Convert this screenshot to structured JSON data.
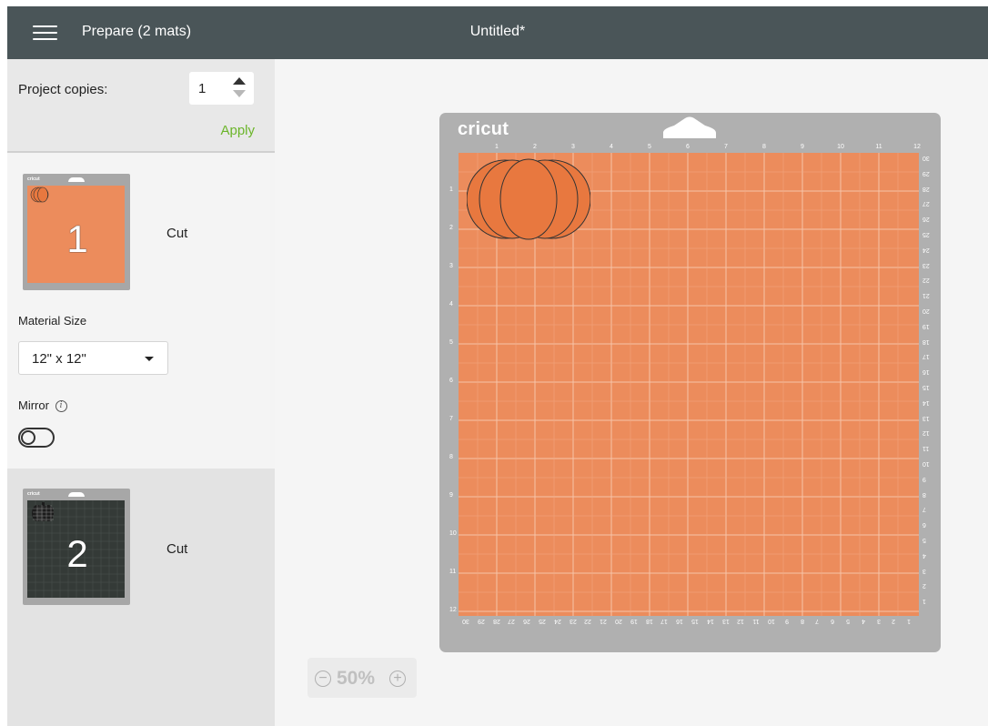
{
  "header": {
    "title": "Prepare (2 mats)",
    "document_title": "Untitled*"
  },
  "sidebar": {
    "project_copies_label": "Project copies:",
    "project_copies_value": "1",
    "apply_label": "Apply",
    "mats": [
      {
        "number": "1",
        "label": "Cut",
        "material_color": "#ec8c5c",
        "thumb_brand": "cricut"
      },
      {
        "number": "2",
        "label": "Cut",
        "material_color": "#343a37",
        "thumb_brand": "cricut"
      }
    ],
    "material_size_label": "Material Size",
    "material_size_value": "12\" x 12\"",
    "mirror_label": "Mirror",
    "mirror_info_glyph": "i",
    "mirror_on": false
  },
  "canvas": {
    "brand": "cricut",
    "ruler_top": [
      "1",
      "2",
      "3",
      "4",
      "5",
      "6",
      "7",
      "8",
      "9",
      "10",
      "11",
      "12"
    ],
    "ruler_left": [
      "1",
      "2",
      "3",
      "4",
      "5",
      "6",
      "7",
      "8",
      "9",
      "10",
      "11",
      "12"
    ],
    "ruler_right": [
      "30",
      "29",
      "28",
      "27",
      "26",
      "25",
      "24",
      "23",
      "22",
      "21",
      "20",
      "19",
      "18",
      "17",
      "16",
      "15",
      "14",
      "13",
      "12",
      "11",
      "10",
      "9",
      "8",
      "7",
      "6",
      "5",
      "4",
      "3",
      "2",
      "1"
    ],
    "ruler_bottom": [
      "30",
      "29",
      "28",
      "27",
      "26",
      "25",
      "24",
      "23",
      "22",
      "21",
      "20",
      "19",
      "18",
      "17",
      "16",
      "15",
      "14",
      "13",
      "12",
      "11",
      "10",
      "9",
      "8",
      "7",
      "6",
      "5",
      "4",
      "3",
      "2",
      "1"
    ],
    "mat_color": "#ec8c5c",
    "design_color": "#e8783f"
  },
  "zoom": {
    "minus": "−",
    "value": "50%",
    "plus": "+"
  },
  "colors": {
    "header_bg": "#4a5558",
    "accent": "#6bb52a"
  },
  "icons": [
    "menu-icon",
    "step-up-icon",
    "step-down-icon",
    "caret-down-icon",
    "info-icon",
    "toggle-switch",
    "zoom-out-icon",
    "zoom-in-icon"
  ]
}
